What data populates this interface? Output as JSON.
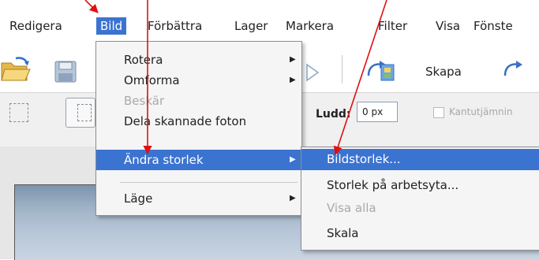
{
  "menubar": {
    "items": [
      "Redigera",
      "Bild",
      "Förbättra",
      "Lager",
      "Markera",
      "Filter",
      "Visa",
      "Fönste"
    ],
    "active_index": 1
  },
  "toolbar": {
    "create_label": "Skapa"
  },
  "options": {
    "feather_label": "Ludd:",
    "feather_value": "0 px",
    "antialias_label": "Kantutjämnin"
  },
  "image_menu": {
    "items": [
      {
        "label": "Rotera",
        "submenu": true,
        "disabled": false
      },
      {
        "label": "Omforma",
        "submenu": true,
        "disabled": false
      },
      {
        "label": "Beskär",
        "submenu": false,
        "disabled": true
      },
      {
        "label": "Dela skannade foton",
        "submenu": false,
        "disabled": false
      },
      {
        "label": "Ändra storlek",
        "submenu": true,
        "disabled": false,
        "highlighted": true
      },
      {
        "label": "Läge",
        "submenu": true,
        "disabled": false
      }
    ],
    "arrow_glyph": "▶"
  },
  "resize_submenu": {
    "items": [
      {
        "label": "Bildstorlek...",
        "highlighted": true,
        "disabled": false
      },
      {
        "label": "Storlek på arbetsyta...",
        "highlighted": false,
        "disabled": false
      },
      {
        "label": "Visa alla",
        "highlighted": false,
        "disabled": true
      },
      {
        "label": "Skala",
        "highlighted": false,
        "disabled": false
      }
    ]
  },
  "colors": {
    "highlight": "#3b73d1",
    "annotation": "#e01010"
  },
  "icons": [
    "open-folder-icon",
    "save-disk-icon",
    "create-project-icon",
    "share-icon",
    "rect-marquee-icon",
    "frame-selection-icon"
  ]
}
